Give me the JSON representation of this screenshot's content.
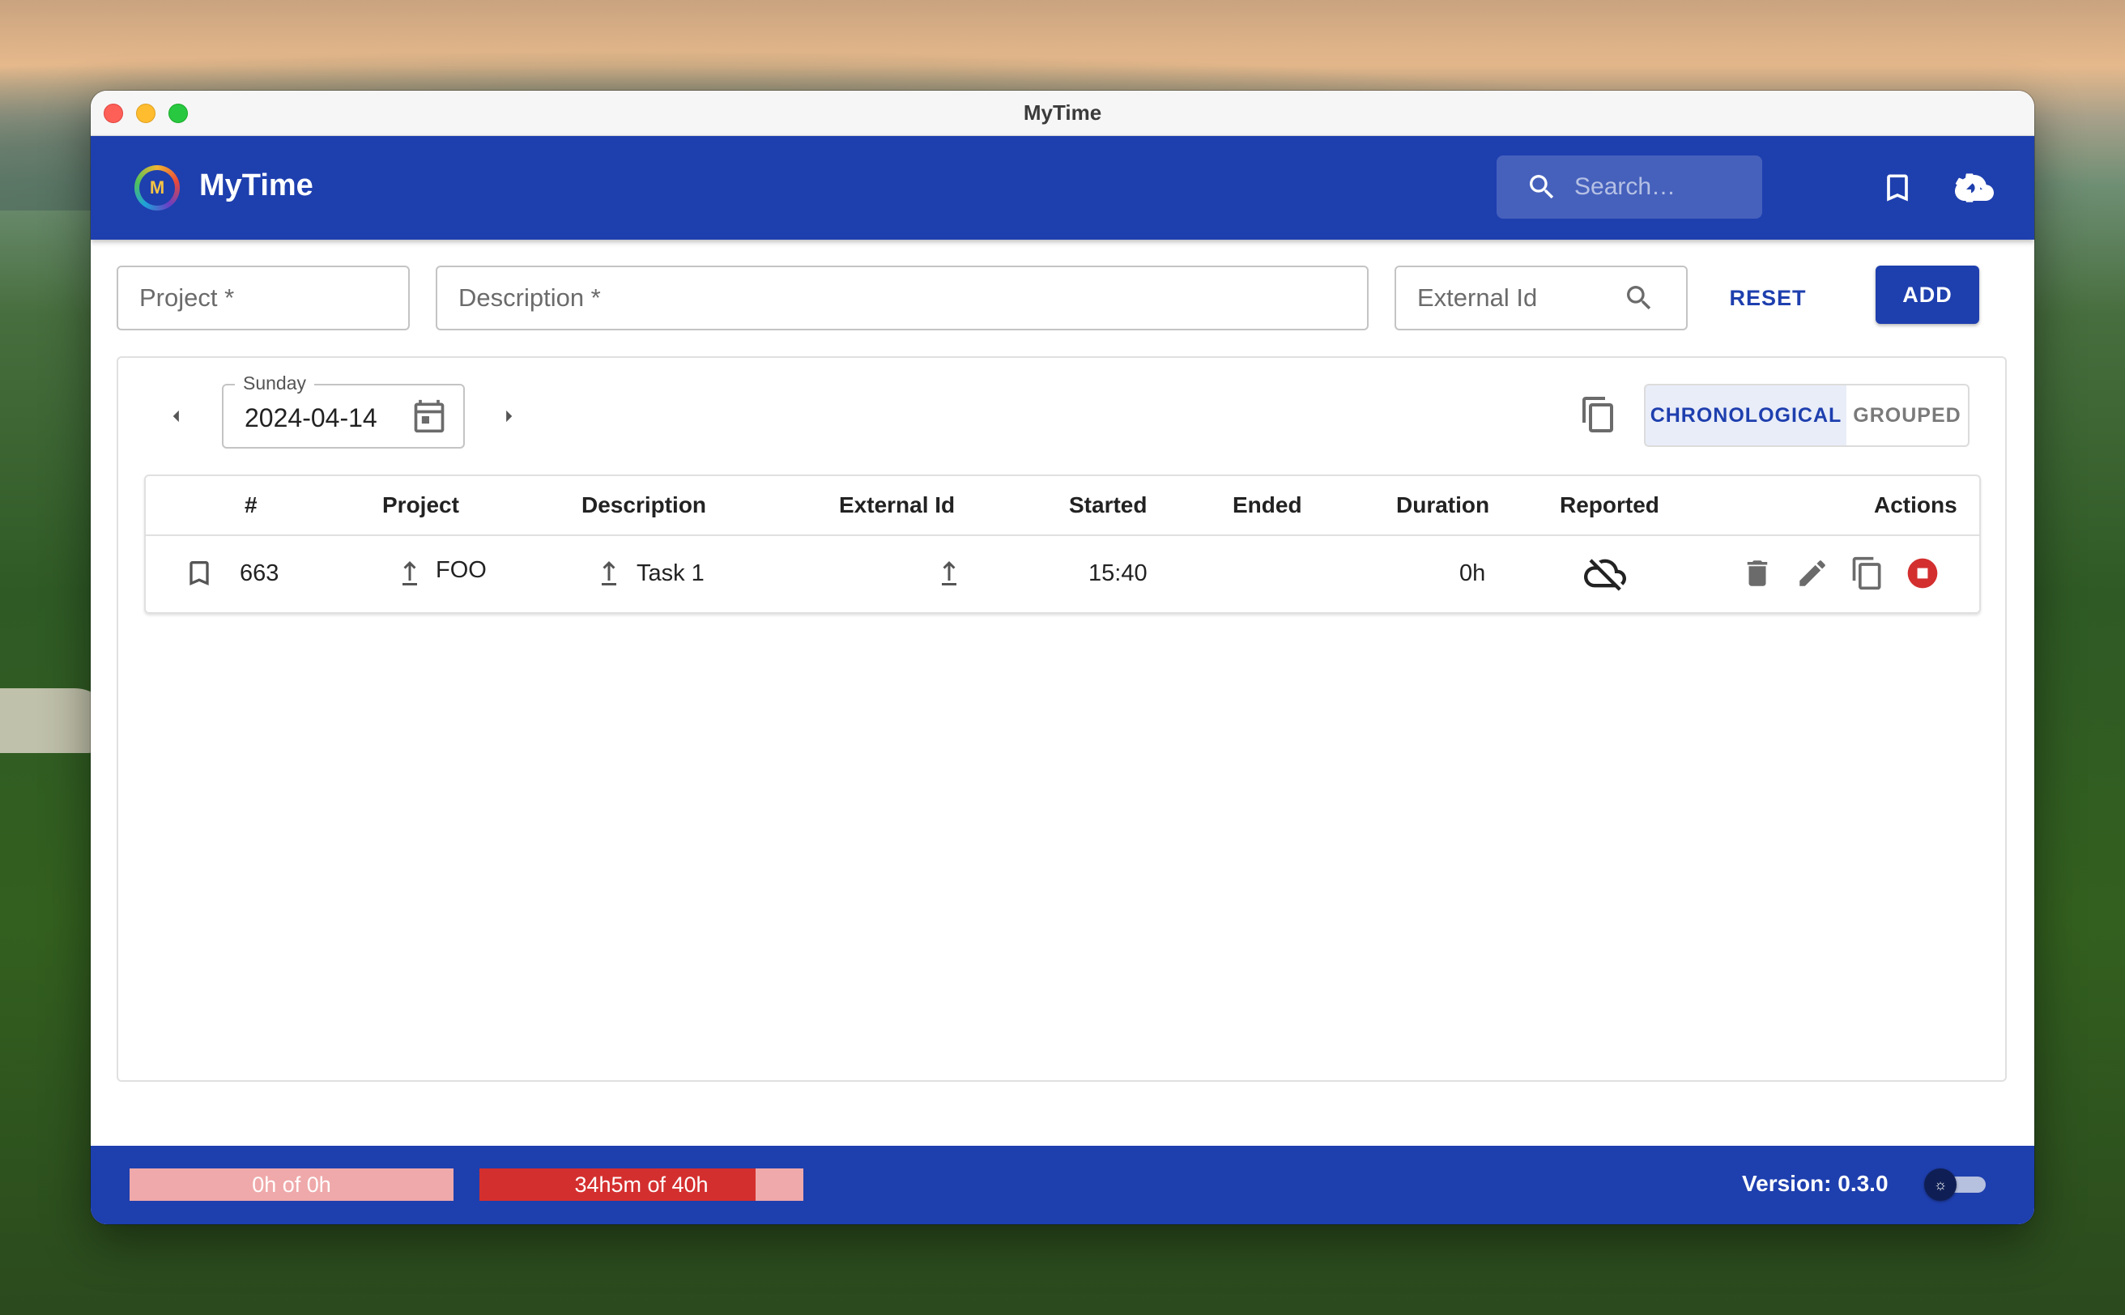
{
  "window": {
    "title": "MyTime"
  },
  "appbar": {
    "app_name": "MyTime",
    "logo_text": "M",
    "search_placeholder": "Search…",
    "icons": [
      "search-icon",
      "bookmark-icon",
      "cloud-upload-icon",
      "gear-icon"
    ]
  },
  "form": {
    "project_placeholder": "Project *",
    "description_placeholder": "Description *",
    "external_id_placeholder": "External Id",
    "reset_label": "RESET",
    "add_label": "ADD"
  },
  "day": {
    "weekday": "Sunday",
    "date": "2024-04-14"
  },
  "view_toggle": {
    "chronological_label": "CHRONOLOGICAL",
    "grouped_label": "GROUPED",
    "selected": "chronological"
  },
  "table": {
    "headers": [
      "#",
      "Project",
      "Description",
      "External Id",
      "Started",
      "Ended",
      "Duration",
      "Reported",
      "Actions"
    ],
    "rows": [
      {
        "id": "663",
        "project": "FOO",
        "description": "Task 1",
        "external_id": "",
        "started": "15:40",
        "ended": "",
        "duration": "0h",
        "reported_icon": "cloud-off-icon"
      }
    ]
  },
  "footer": {
    "day_progress": {
      "label": "0h of 0h",
      "fraction": 0.0
    },
    "week_progress": {
      "label": "34h5m of 40h",
      "fraction": 0.853
    },
    "version": "Version: 0.3.0",
    "theme_icon": "sun-icon"
  },
  "colors": {
    "primary": "#1e3fae",
    "progress_fill": "#d42f2f",
    "progress_track": "#efa9aa",
    "stop": "#d32f2f"
  }
}
